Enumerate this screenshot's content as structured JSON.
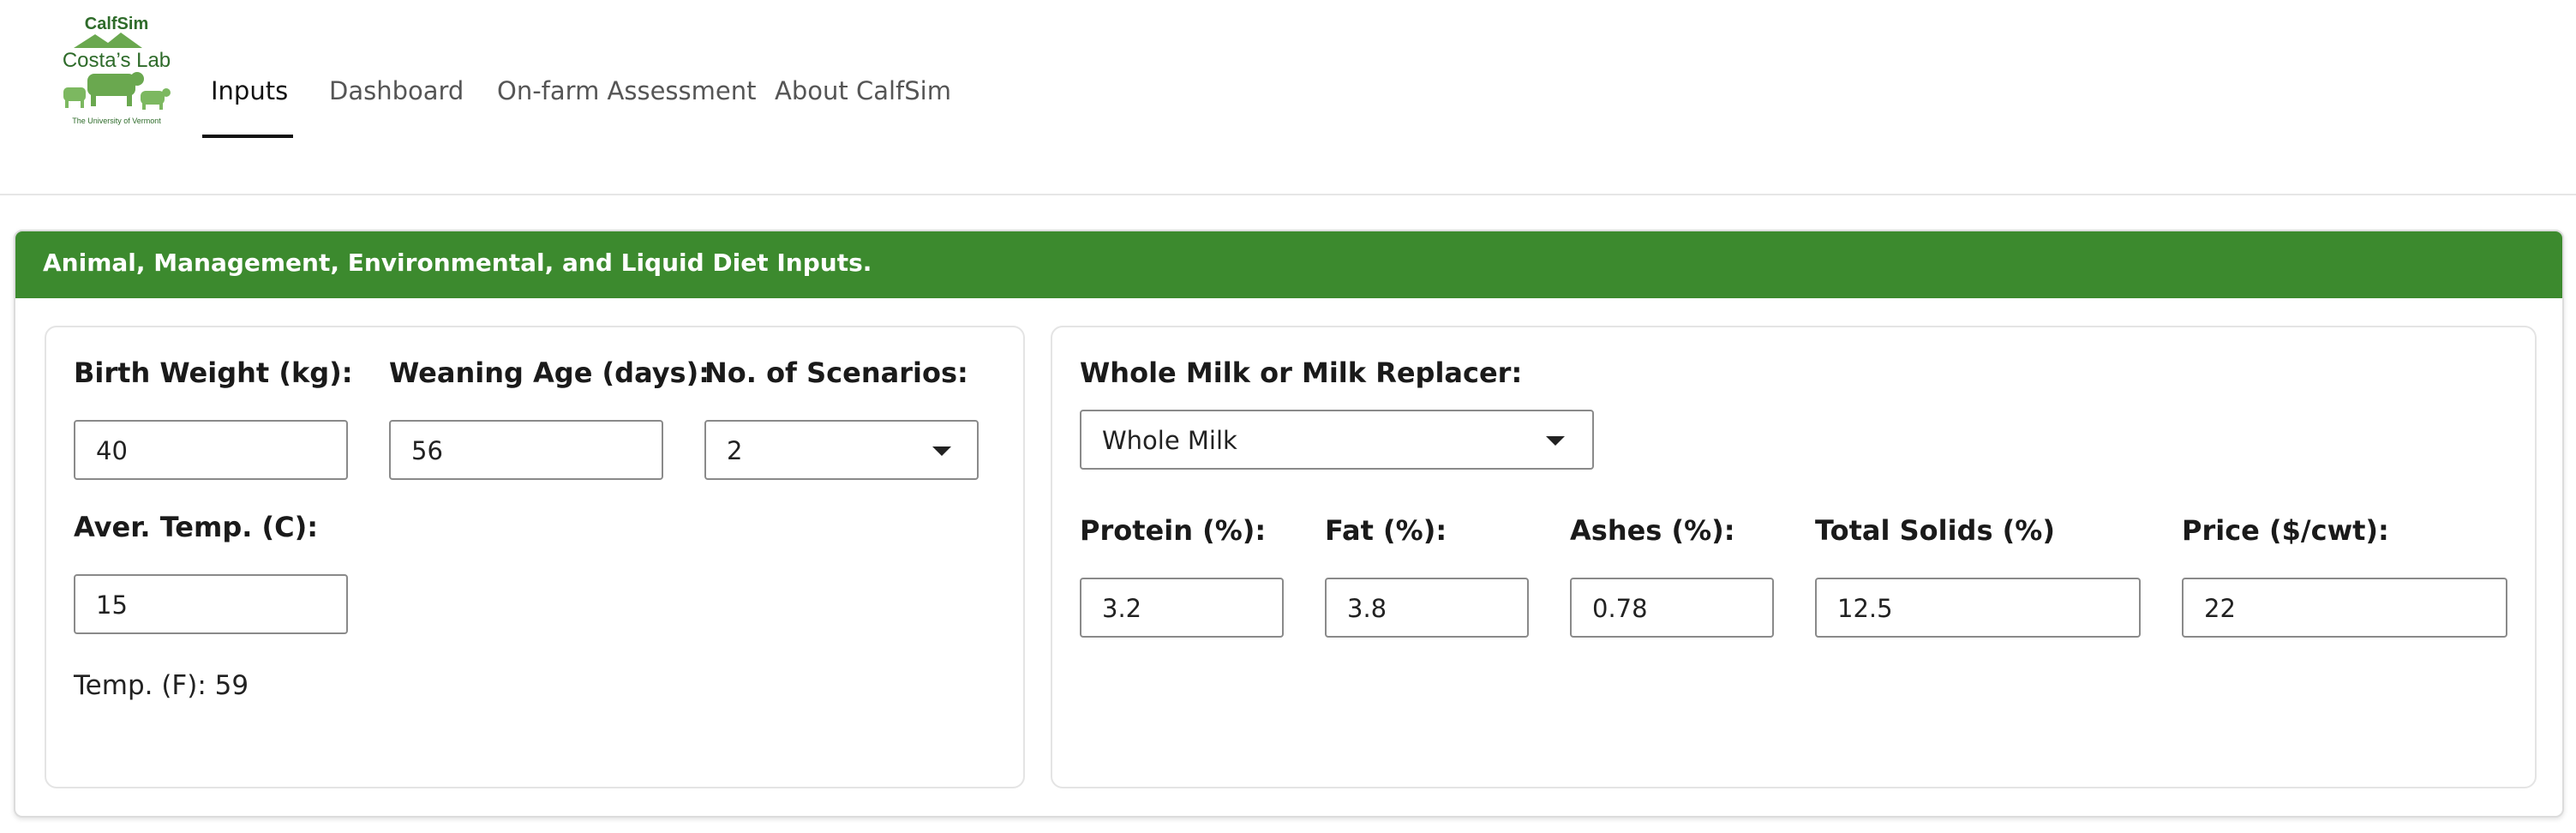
{
  "logo": {
    "brand": "CalfSim",
    "lab": "Costa’s Lab",
    "university": "The University of Vermont"
  },
  "nav": {
    "tabs": [
      "Inputs",
      "Dashboard",
      "On-farm Assessment",
      "About CalfSim"
    ],
    "active_tab": "Inputs"
  },
  "card": {
    "header": "Animal, Management, Environmental, and Liquid Diet Inputs."
  },
  "left_panel": {
    "birth_weight": {
      "label": "Birth Weight (kg):",
      "value": "40"
    },
    "weaning_age": {
      "label": "Weaning Age (days):",
      "value": "56"
    },
    "scenarios": {
      "label": "No. of Scenarios:",
      "value": "2"
    },
    "avg_temp": {
      "label": "Aver. Temp. (C):",
      "value": "15"
    },
    "temp_f": "Temp. (F): 59"
  },
  "right_panel": {
    "milk_type": {
      "label": "Whole Milk or Milk Replacer:",
      "value": "Whole Milk"
    },
    "protein": {
      "label": "Protein (%):",
      "value": "3.2"
    },
    "fat": {
      "label": "Fat (%):",
      "value": "3.8"
    },
    "ashes": {
      "label": "Ashes (%):",
      "value": "0.78"
    },
    "total_solids": {
      "label": "Total Solids (%)",
      "value": "12.5"
    },
    "price": {
      "label": "Price ($/cwt):",
      "value": "22"
    }
  },
  "colors": {
    "header_green": "#3c8a2e",
    "logo_green": "#4a8a3c",
    "logo_dark_green": "#2e6b2a"
  }
}
